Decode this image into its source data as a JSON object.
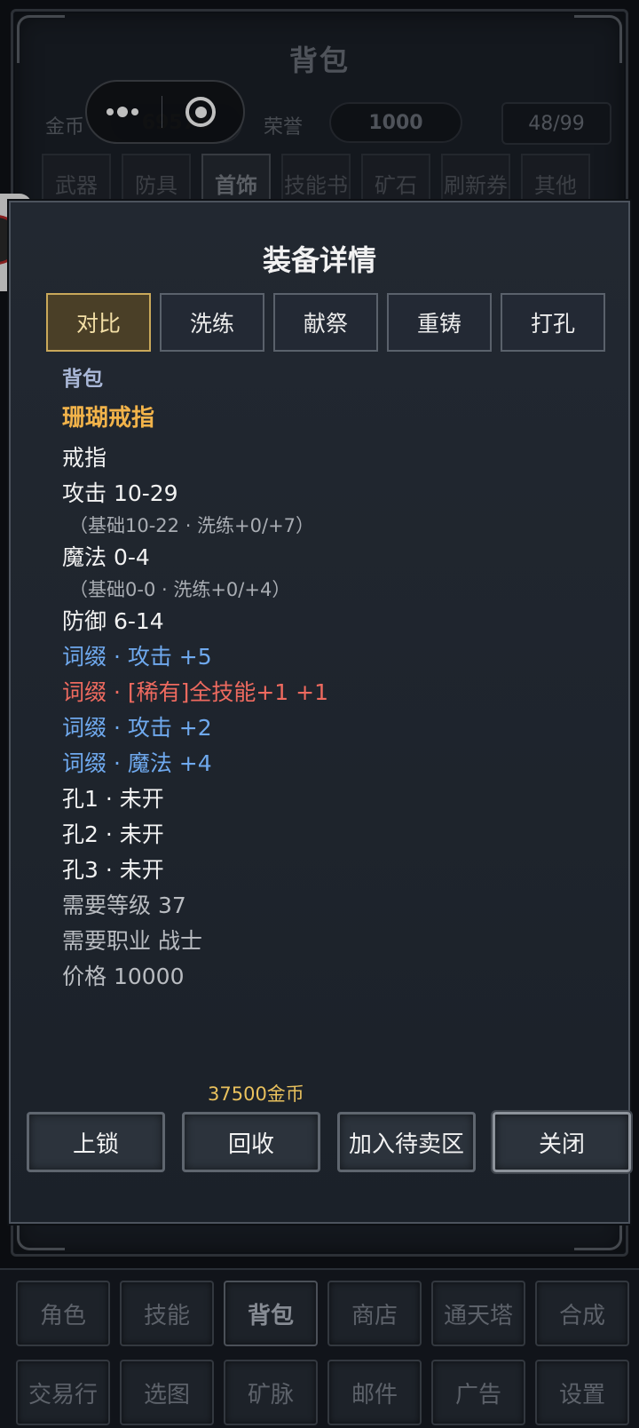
{
  "bag": {
    "title": "背包",
    "gold_label": "金币",
    "gold_value": "69578",
    "honor_label": "荣誉",
    "honor_value": "1000",
    "capacity": "48/99",
    "tabs": [
      {
        "label": "武器",
        "active": false
      },
      {
        "label": "防具",
        "active": false
      },
      {
        "label": "首饰",
        "active": true
      },
      {
        "label": "技能书",
        "active": false
      },
      {
        "label": "矿石",
        "active": false
      },
      {
        "label": "刷新券",
        "active": false
      },
      {
        "label": "其他",
        "active": false
      }
    ]
  },
  "modal": {
    "title": "装备详情",
    "tabs": [
      {
        "label": "对比",
        "active": true
      },
      {
        "label": "洗练",
        "active": false
      },
      {
        "label": "献祭",
        "active": false
      },
      {
        "label": "重铸",
        "active": false
      },
      {
        "label": "打孔",
        "active": false
      }
    ],
    "source": "背包",
    "item_name": "珊瑚戒指",
    "item_type": "戒指",
    "attack": "攻击 10-29",
    "attack_detail": "（基础10-22 · 洗练+0/+7）",
    "magic": "魔法 0-4",
    "magic_detail": "（基础0-0 · 洗练+0/+4）",
    "defense": "防御 6-14",
    "affixes": [
      {
        "text": "词缀 · 攻击 +5",
        "rarity": "normal"
      },
      {
        "text": "词缀 · [稀有]全技能+1 +1",
        "rarity": "rare"
      },
      {
        "text": "词缀 · 攻击 +2",
        "rarity": "normal"
      },
      {
        "text": "词缀 · 魔法 +4",
        "rarity": "normal"
      }
    ],
    "sockets": [
      "孔1 · 未开",
      "孔2 · 未开",
      "孔3 · 未开"
    ],
    "req_level": "需要等级 37",
    "req_class": "需要职业 战士",
    "price": "价格 10000",
    "recycle_value": "37500金币",
    "buttons": {
      "lock": "上锁",
      "recycle": "回收",
      "add_to_sell": "加入待卖区",
      "close": "关闭"
    }
  },
  "nav": {
    "row1": [
      "角色",
      "技能",
      "背包",
      "商店",
      "通天塔",
      "合成"
    ],
    "row2": [
      "交易行",
      "选图",
      "矿脉",
      "邮件",
      "广告",
      "设置"
    ],
    "active": "背包"
  },
  "colors": {
    "accent_gold": "#f2b34a",
    "affix_normal": "#6fa9ee",
    "affix_rare": "#ee6a5f",
    "tab_active_border": "#c9a85a"
  }
}
